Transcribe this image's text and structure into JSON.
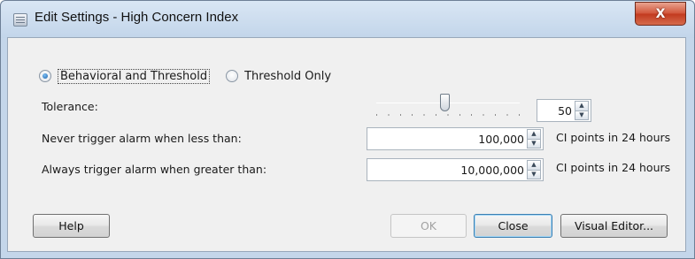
{
  "window": {
    "title": "Edit Settings - High Concern Index",
    "close_glyph": "X",
    "icon": "settings-window-icon"
  },
  "mode": {
    "options": [
      {
        "label": "Behavioral and Threshold",
        "selected": true
      },
      {
        "label": "Threshold Only",
        "selected": false
      }
    ]
  },
  "tolerance": {
    "label": "Tolerance:",
    "slider_level_percent": 48,
    "value": "50"
  },
  "never_trigger": {
    "label": "Never trigger alarm when less than:",
    "value": "100,000",
    "unit": "CI points in 24 hours"
  },
  "always_trigger": {
    "label": "Always trigger alarm when greater than:",
    "value": "10,000,000",
    "unit": "CI points in 24 hours"
  },
  "buttons": {
    "help": "Help",
    "ok": "OK",
    "close": "Close",
    "visual_editor": "Visual Editor..."
  },
  "icons": {
    "spin_up": "▲",
    "spin_down": "▼"
  },
  "colors": {
    "title_bar": "#c4d6ea",
    "close_button": "#c94a2c",
    "radio_selected": "#1a5fa8",
    "default_button_border": "#3c7fb1"
  }
}
